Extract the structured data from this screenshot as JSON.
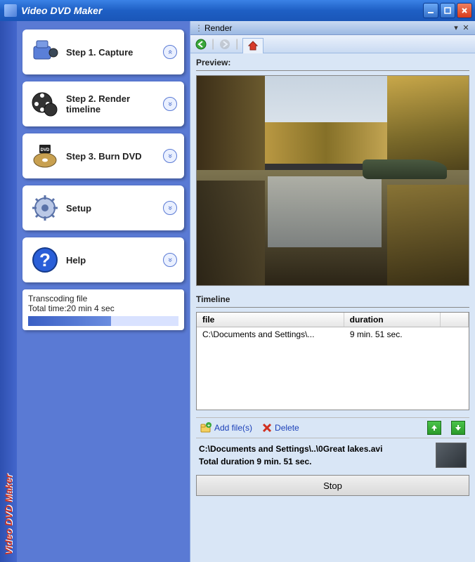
{
  "window": {
    "title": "Video DVD Maker"
  },
  "sidebar": {
    "brand": "Video DVD Maker",
    "items": [
      {
        "label": "Step 1. Capture",
        "chev": "«",
        "icon": "camcorder-icon"
      },
      {
        "label": "Step 2. Render\ntimeline",
        "chev": "»",
        "icon": "film-reel-icon"
      },
      {
        "label": "Step 3. Burn DVD",
        "chev": "»",
        "icon": "burn-dvd-icon"
      },
      {
        "label": "Setup",
        "chev": "»",
        "icon": "gear-icon"
      },
      {
        "label": "Help",
        "chev": "»",
        "icon": "help-icon"
      }
    ],
    "status": {
      "line1": "Transcoding file",
      "line2": "Total time:20 min 4 sec",
      "progress_pct": 55
    }
  },
  "main": {
    "render_label": "Render",
    "preview_label": "Preview:",
    "timeline_label": "Timeline",
    "table": {
      "headers": {
        "file": "file",
        "duration": "duration"
      },
      "rows": [
        {
          "file": "C:\\Documents and Settings\\...",
          "duration": "9 min. 51 sec."
        }
      ]
    },
    "actions": {
      "add": "Add file(s)",
      "delete": "Delete"
    },
    "summary": {
      "path": "C:\\Documents and Settings\\..\\0Great lakes.avi",
      "duration": "Total duration 9 min. 51 sec."
    },
    "stop_label": "Stop"
  }
}
